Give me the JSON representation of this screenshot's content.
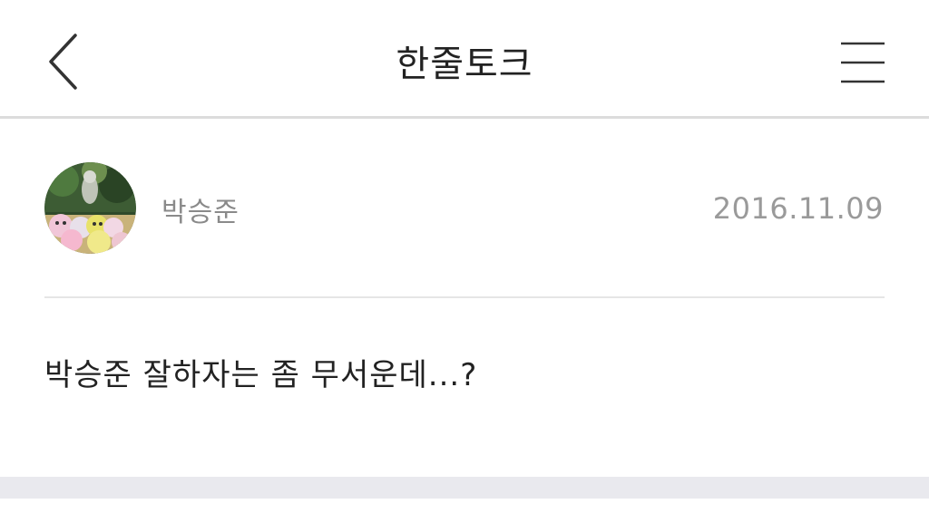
{
  "header": {
    "title": "한줄토크",
    "back_icon": "chevron-left-icon",
    "menu_icon": "hamburger-menu-icon"
  },
  "post": {
    "author": "박승준",
    "date": "2016.11.09",
    "body": "박승준 잘하자는 좀 무서운데...?",
    "avatar_icon": "avatar-image"
  },
  "colors": {
    "background": "#ffffff",
    "divider": "#dcdcdc",
    "muted_text": "#8a8a8a",
    "primary_text": "#222222",
    "band": "#e9e9ee"
  }
}
